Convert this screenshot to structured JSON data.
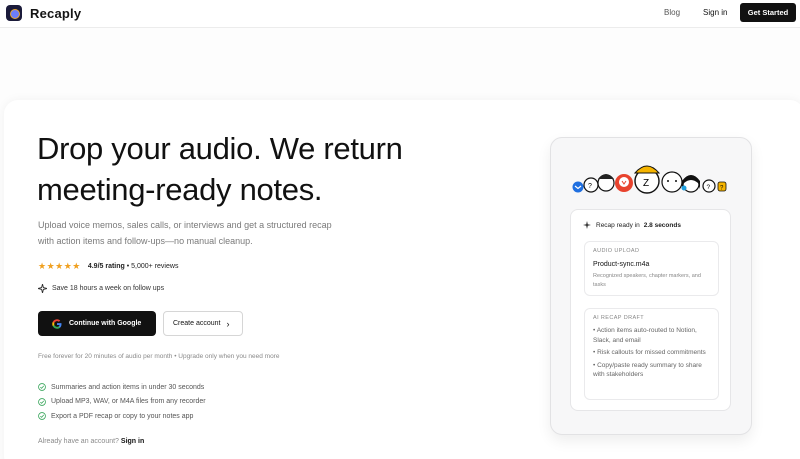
{
  "nav": {
    "brand": "Recaply",
    "blog": "Blog",
    "sign_in": "Sign in",
    "get_started": "Get Started"
  },
  "hero": {
    "headline": "Drop your audio. We return meeting-ready notes.",
    "subtext": "Upload voice memos, sales calls, or interviews and get a structured recap with action items and follow-ups—no manual cleanup.",
    "rating_score": "4.9/5 rating",
    "rating_reviews": "• 5,000+ reviews",
    "save_text": "Save 18 hours a week on follow ups",
    "google_button": "Continue with Google",
    "create_account": "Create account",
    "free_note": "Free forever for 20 minutes of audio per month • Upgrade only when you need more",
    "features": [
      "Summaries and action items in under 30 seconds",
      "Upload MP3, WAV, or M4A files from any recorder",
      "Export a PDF recap or copy to your notes app"
    ],
    "already_text": "Already have an account?",
    "already_link": "Sign in"
  },
  "preview": {
    "recap_ready": "Recap ready in",
    "recap_seconds": "2.8 seconds",
    "upload_label": "AUDIO UPLOAD",
    "file_name": "Product-sync.m4a",
    "file_desc": "Recognized speakers, chapter markers, and tasks",
    "draft_label": "AI RECAP DRAFT",
    "draft_bullets": [
      "• Action items auto-routed to Notion, Slack, and email",
      "• Risk callouts for missed commitments",
      "• Copy/paste ready summary to share with stakeholders"
    ]
  },
  "colors": {
    "accent_dark": "#111111",
    "star": "#f0a020",
    "check": "#3aa65c"
  },
  "icons": [
    "logo-icon",
    "star-icon",
    "sparkle-icon",
    "google-icon",
    "chevron-right-icon",
    "check-circle-icon",
    "avatar-icon"
  ]
}
